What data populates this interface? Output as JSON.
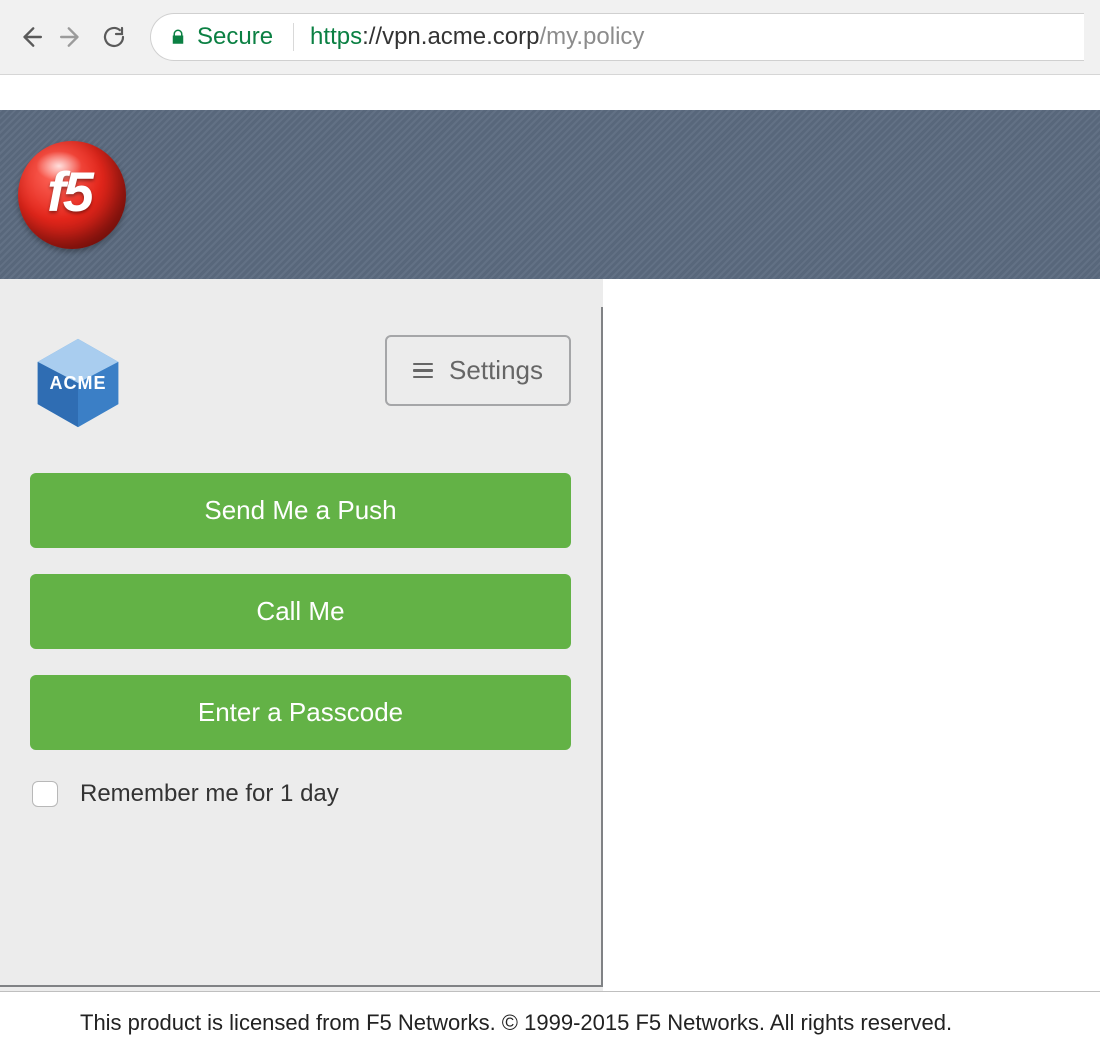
{
  "browser": {
    "secure_label": "Secure",
    "url_scheme": "https",
    "url_host": "://vpn.acme.corp",
    "url_path": "/my.policy"
  },
  "banner": {
    "logo_text": "f5"
  },
  "duo": {
    "company_logo_text": "ACME",
    "settings_label": "Settings",
    "buttons": {
      "push": "Send Me a Push",
      "call": "Call Me",
      "passcode": "Enter a Passcode"
    },
    "remember_label": "Remember me for 1 day"
  },
  "footer": {
    "text": "This product is licensed from F5 Networks. © 1999-2015 F5 Networks. All rights reserved."
  },
  "colors": {
    "button_green": "#63b246",
    "banner_bg": "#5c6b80",
    "secure_green": "#0b8043"
  }
}
